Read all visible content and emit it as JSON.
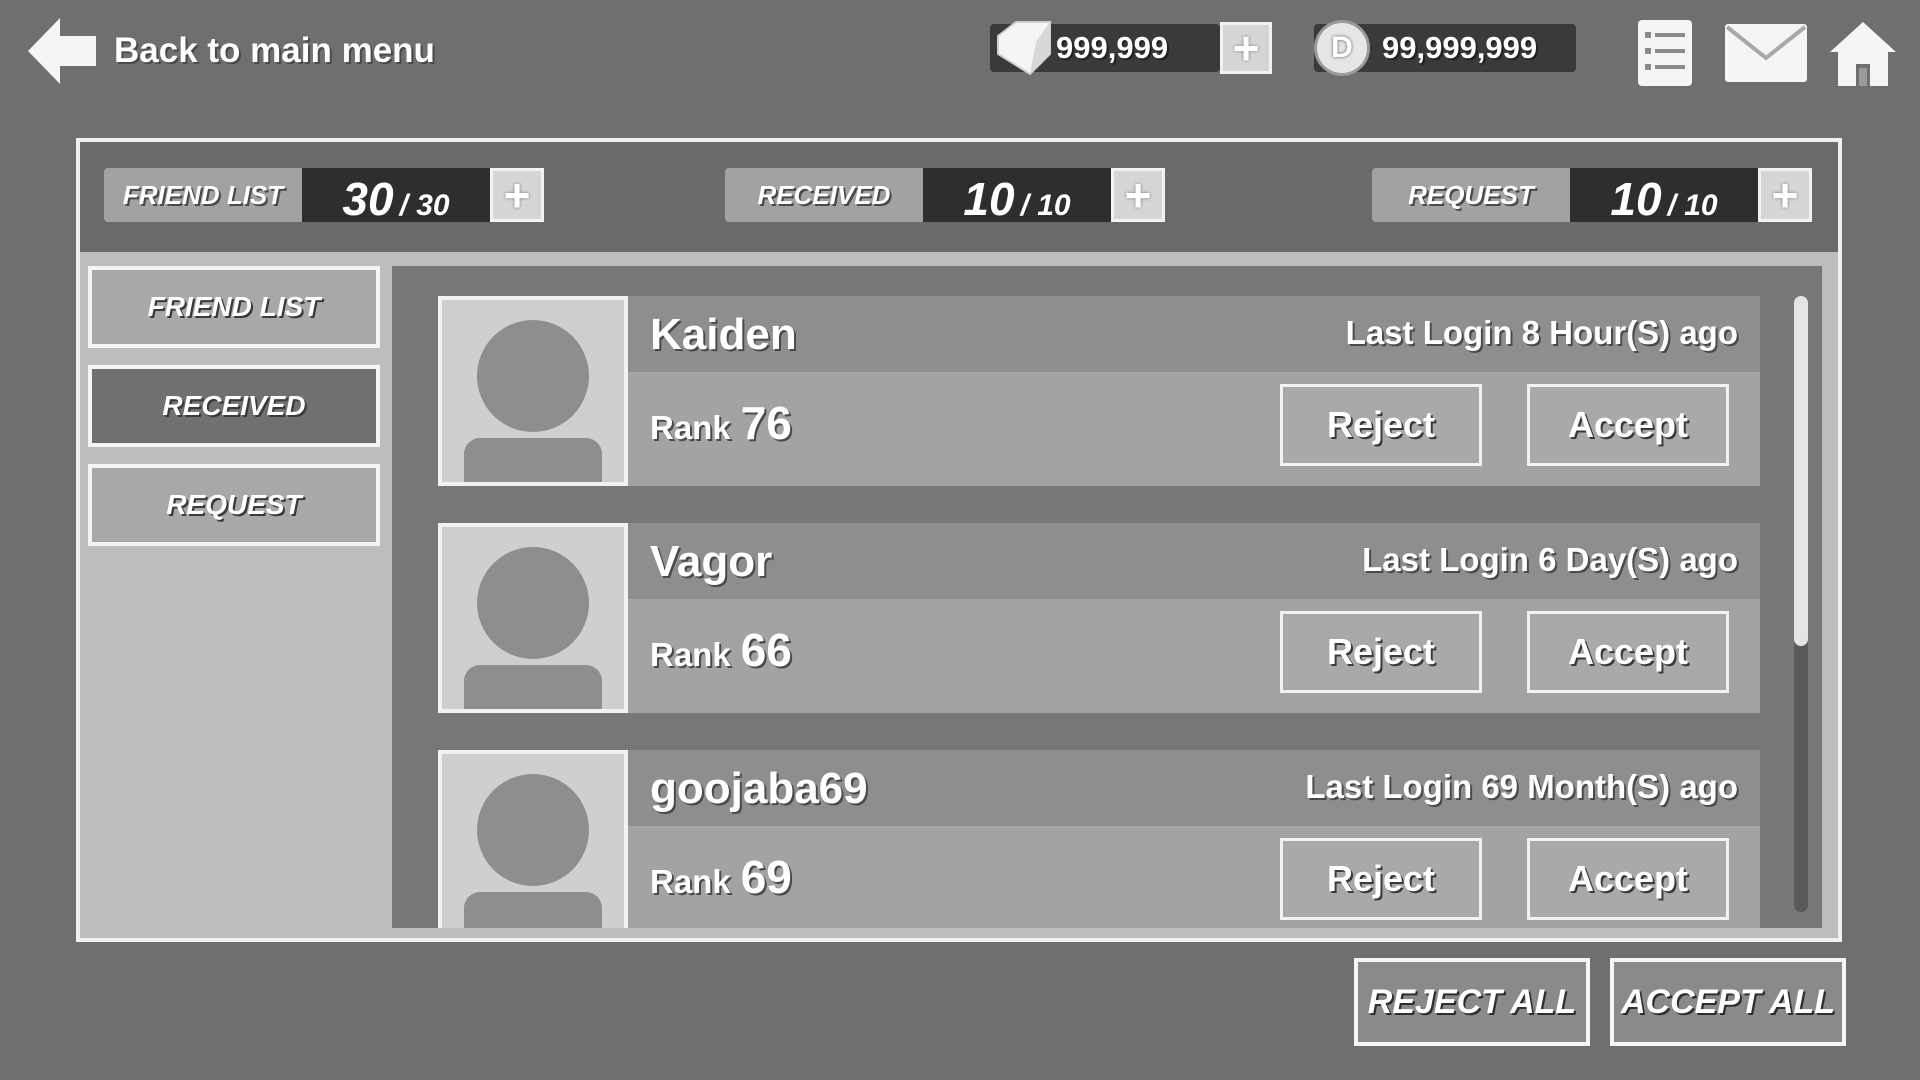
{
  "header": {
    "back_label": "Back to main menu",
    "gems": "999,999",
    "coins": "99,999,999",
    "coin_symbol": "D",
    "plus": "+"
  },
  "stats": [
    {
      "label": "FRIEND LIST",
      "value": "30",
      "max": "/ 30"
    },
    {
      "label": "RECEIVED",
      "value": "10",
      "max": "/ 10"
    },
    {
      "label": "REQUEST",
      "value": "10",
      "max": "/ 10"
    }
  ],
  "sidebar": {
    "items": [
      {
        "label": "FRIEND LIST"
      },
      {
        "label": "RECEIVED"
      },
      {
        "label": "REQUEST"
      }
    ],
    "active": "RECEIVED"
  },
  "requests": [
    {
      "name": "Kaiden",
      "login": "Last Login 8 Hour(S) ago",
      "rank_label": "Rank",
      "rank": "76",
      "reject": "Reject",
      "accept": "Accept"
    },
    {
      "name": "Vagor",
      "login": "Last Login 6 Day(S) ago",
      "rank_label": "Rank",
      "rank": "66",
      "reject": "Reject",
      "accept": "Accept"
    },
    {
      "name": "goojaba69",
      "login": "Last Login 69 Month(S) ago",
      "rank_label": "Rank",
      "rank": "69",
      "reject": "Reject",
      "accept": "Accept"
    }
  ],
  "footer": {
    "reject_all": "REJECT ALL",
    "accept_all": "ACCEPT ALL"
  },
  "icons": {
    "back": "back-arrow-icon",
    "gem": "gem-icon",
    "coin": "coin-icon",
    "quest": "checklist-icon",
    "mail": "mail-icon",
    "home": "home-icon"
  }
}
